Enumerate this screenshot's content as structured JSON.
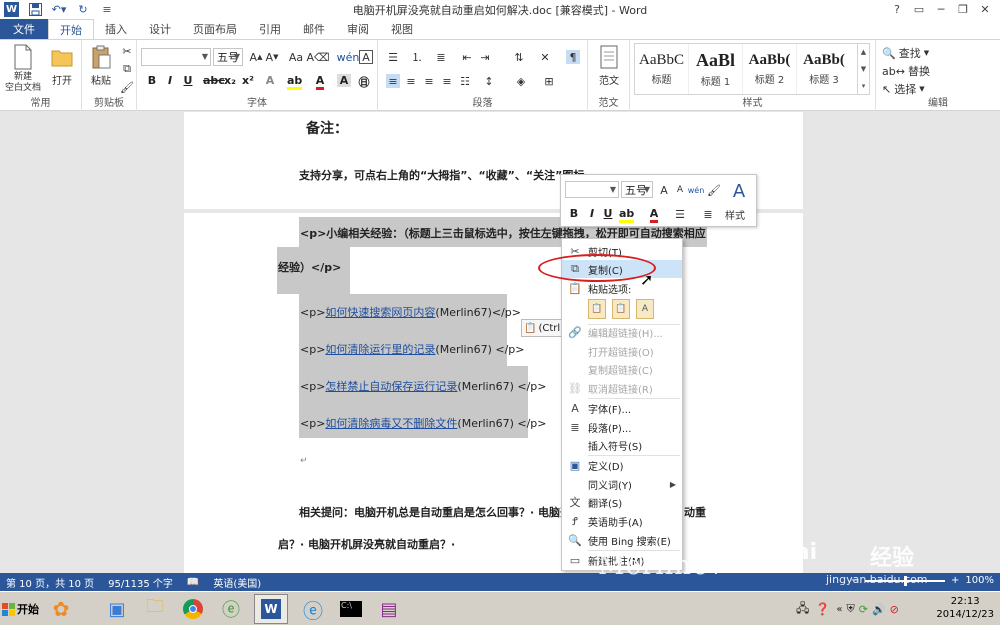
{
  "window": {
    "title": "电脑开机屏没亮就自动重启如何解决.doc [兼容模式] - Word",
    "controls": [
      "?",
      "▭",
      "─",
      "❐",
      "✕"
    ]
  },
  "tabs": [
    "文件",
    "开始",
    "插入",
    "设计",
    "页面布局",
    "引用",
    "邮件",
    "审阅",
    "视图"
  ],
  "ribbon": {
    "groups": {
      "common": "常用",
      "clipboard": "剪贴板",
      "font": "字体",
      "paragraph": "段落",
      "fanwen": "范文",
      "styles": "样式",
      "editing": "编辑"
    },
    "new_label": "新建\n空白文档",
    "open_label": "打开",
    "paste_label": "粘贴",
    "font_size": "五号",
    "fanwen_btn": "范文",
    "styles": [
      {
        "preview": "AaBbC",
        "name": "标题"
      },
      {
        "preview": "AaBl",
        "name": "标题 1"
      },
      {
        "preview": "AaBb(",
        "name": "标题 2"
      },
      {
        "preview": "AaBb(",
        "name": "标题 3"
      }
    ],
    "edit": {
      "find": "查找",
      "replace": "替换",
      "select": "选择"
    }
  },
  "document": {
    "note_heading": "备注：",
    "share_line": "支持分享，可点右上角的“大拇指”、“收藏”、“关注”图标。",
    "para1_part1": "<p>小编相关经验：（标题上三击鼠标选中，按住左键拖拽，松开即可自动搜索相应",
    "para1_part2": "经验）</p>",
    "links": [
      {
        "prefix": "<p>",
        "link": "如何快速搜索网页内容",
        "suffix": "(Merlin67)</p>"
      },
      {
        "prefix": "<p>",
        "link": "如何清除运行里的记录",
        "suffix": "(Merlin67) </p>"
      },
      {
        "prefix": "<p>",
        "link": "怎样禁止自动保存运行记录",
        "suffix": "(Merlin67) </p>"
      },
      {
        "prefix": "<p>",
        "link": "如何清除病毒又不删除文件",
        "suffix": "(Merlin67) </p>"
      }
    ],
    "related_part1": "相关提问：电脑开机总是自动重启是怎么回事？· 电脑开",
    "related_part1b": "动重",
    "related_part2": "启？· 电脑开机屏没亮就自动重启？·",
    "paste_tag": "(Ctrl)",
    "para_mark": "↵"
  },
  "mini_toolbar": {
    "font_size": "五号",
    "styles_label": "样式"
  },
  "context_menu": {
    "items": [
      {
        "label": "剪切(T)",
        "icon": "scissors-icon",
        "enabled": true
      },
      {
        "label": "复制(C)",
        "icon": "copy-icon",
        "enabled": true
      },
      {
        "label": "粘贴选项:",
        "icon": "paste-icon",
        "enabled": true
      },
      {
        "label": "编辑超链接(H)...",
        "icon": "link-icon",
        "enabled": false
      },
      {
        "label": "打开超链接(O)",
        "icon": "",
        "enabled": false
      },
      {
        "label": "复制超链接(C)",
        "icon": "",
        "enabled": false
      },
      {
        "label": "取消超链接(R)",
        "icon": "unlink-icon",
        "enabled": false
      },
      {
        "label": "字体(F)...",
        "icon": "font-icon",
        "enabled": true
      },
      {
        "label": "段落(P)...",
        "icon": "paragraph-icon",
        "enabled": true
      },
      {
        "label": "插入符号(S)",
        "icon": "",
        "enabled": true
      },
      {
        "label": "定义(D)",
        "icon": "define-icon",
        "enabled": true
      },
      {
        "label": "同义词(Y)",
        "icon": "",
        "enabled": true
      },
      {
        "label": "翻译(S)",
        "icon": "translate-icon",
        "enabled": true
      },
      {
        "label": "英语助手(A)",
        "icon": "english-assistant-icon",
        "enabled": true
      },
      {
        "label": "使用 Bing 搜索(E)",
        "icon": "search-icon",
        "enabled": true
      },
      {
        "label": "新建批注(M)",
        "icon": "comment-icon",
        "enabled": true
      }
    ]
  },
  "status_bar": {
    "page": "第 10 页，共 10 页",
    "words": "95/1135 个字",
    "language": "英语(美国)",
    "zoom": "100%",
    "zoom_level": 1.0
  },
  "taskbar": {
    "start": "开始",
    "time": "22:13",
    "date": "2014/12/23"
  },
  "watermark": {
    "text1": "Merlin67",
    "text2": "Bai",
    "text3": "经验",
    "url": "jingyan.baidu.com"
  },
  "colors": {
    "accent": "#2b579a",
    "highlight_ellipse": "#d81e1e",
    "selection": "#c8c8c8",
    "link": "#1f4e9e"
  }
}
